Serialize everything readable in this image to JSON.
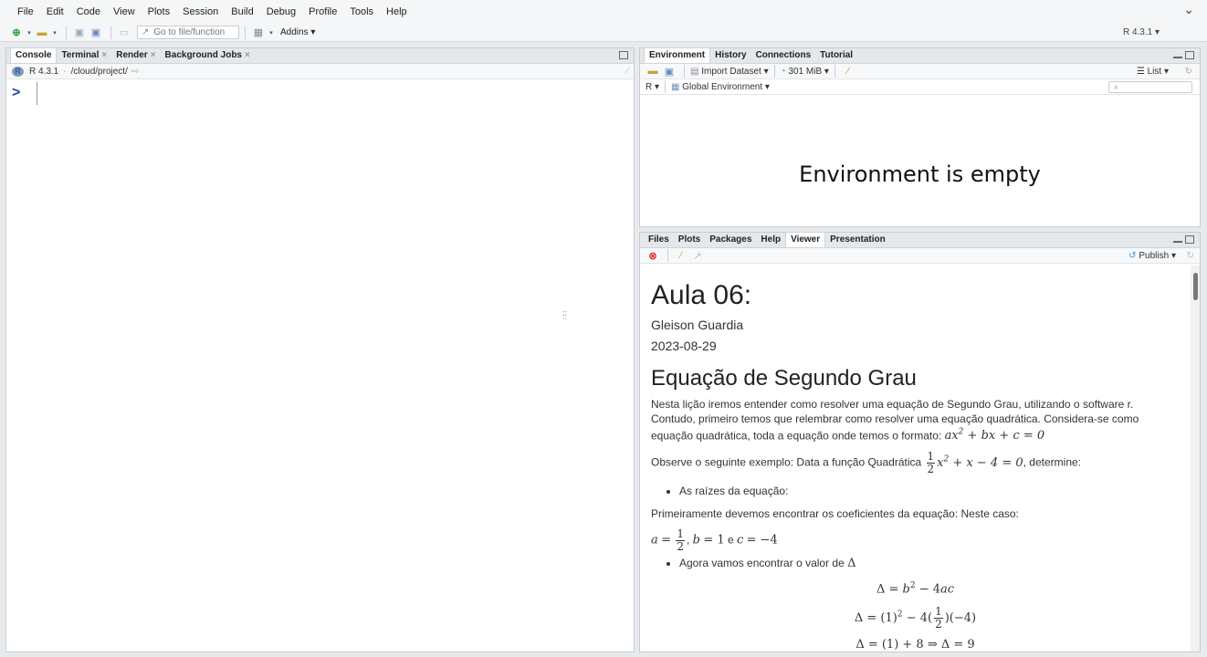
{
  "menu": [
    "File",
    "Edit",
    "Code",
    "View",
    "Plots",
    "Session",
    "Build",
    "Debug",
    "Profile",
    "Tools",
    "Help"
  ],
  "toolbar": {
    "goto_placeholder": "Go to file/function",
    "addins_label": "Addins",
    "r_version": "R 4.3.1"
  },
  "console": {
    "tabs": [
      "Console",
      "Terminal",
      "Render",
      "Background Jobs"
    ],
    "r_version": "R 4.3.1",
    "dot": "·",
    "path": "/cloud/project/",
    "prompt": ">"
  },
  "environment": {
    "tabs": [
      "Environment",
      "History",
      "Connections",
      "Tutorial"
    ],
    "import_dataset": "Import Dataset",
    "memory": "301 MiB",
    "list_label": "List",
    "language": "R",
    "scope": "Global Environment",
    "empty_message": "Environment is empty"
  },
  "files": {
    "tabs": [
      "Files",
      "Plots",
      "Packages",
      "Help",
      "Viewer",
      "Presentation"
    ],
    "publish_label": "Publish"
  },
  "viewer": {
    "title": "Aula 06:",
    "author": "Gleison Guardia",
    "date": "2023-08-29",
    "heading": "Equação de Segundo Grau",
    "intro": "Nesta lição iremos entender como resolver uma equação de Segundo Grau, utilizando o software r. Contudo, primeiro temos que relembrar como resolver uma equação quadrática. Considera-se como equação quadrática, toda a equação onde temos o formato:",
    "example_pre": "Observe o seguinte exemplo: Data a função Quadrática",
    "example_post": ", determine:",
    "bullet1": "As raízes da equação:",
    "coef_text": "Primeiramente devemos encontrar os coeficientes da equação: Neste caso:",
    "bullet2": "Agora vamos encontrar o valor de"
  }
}
